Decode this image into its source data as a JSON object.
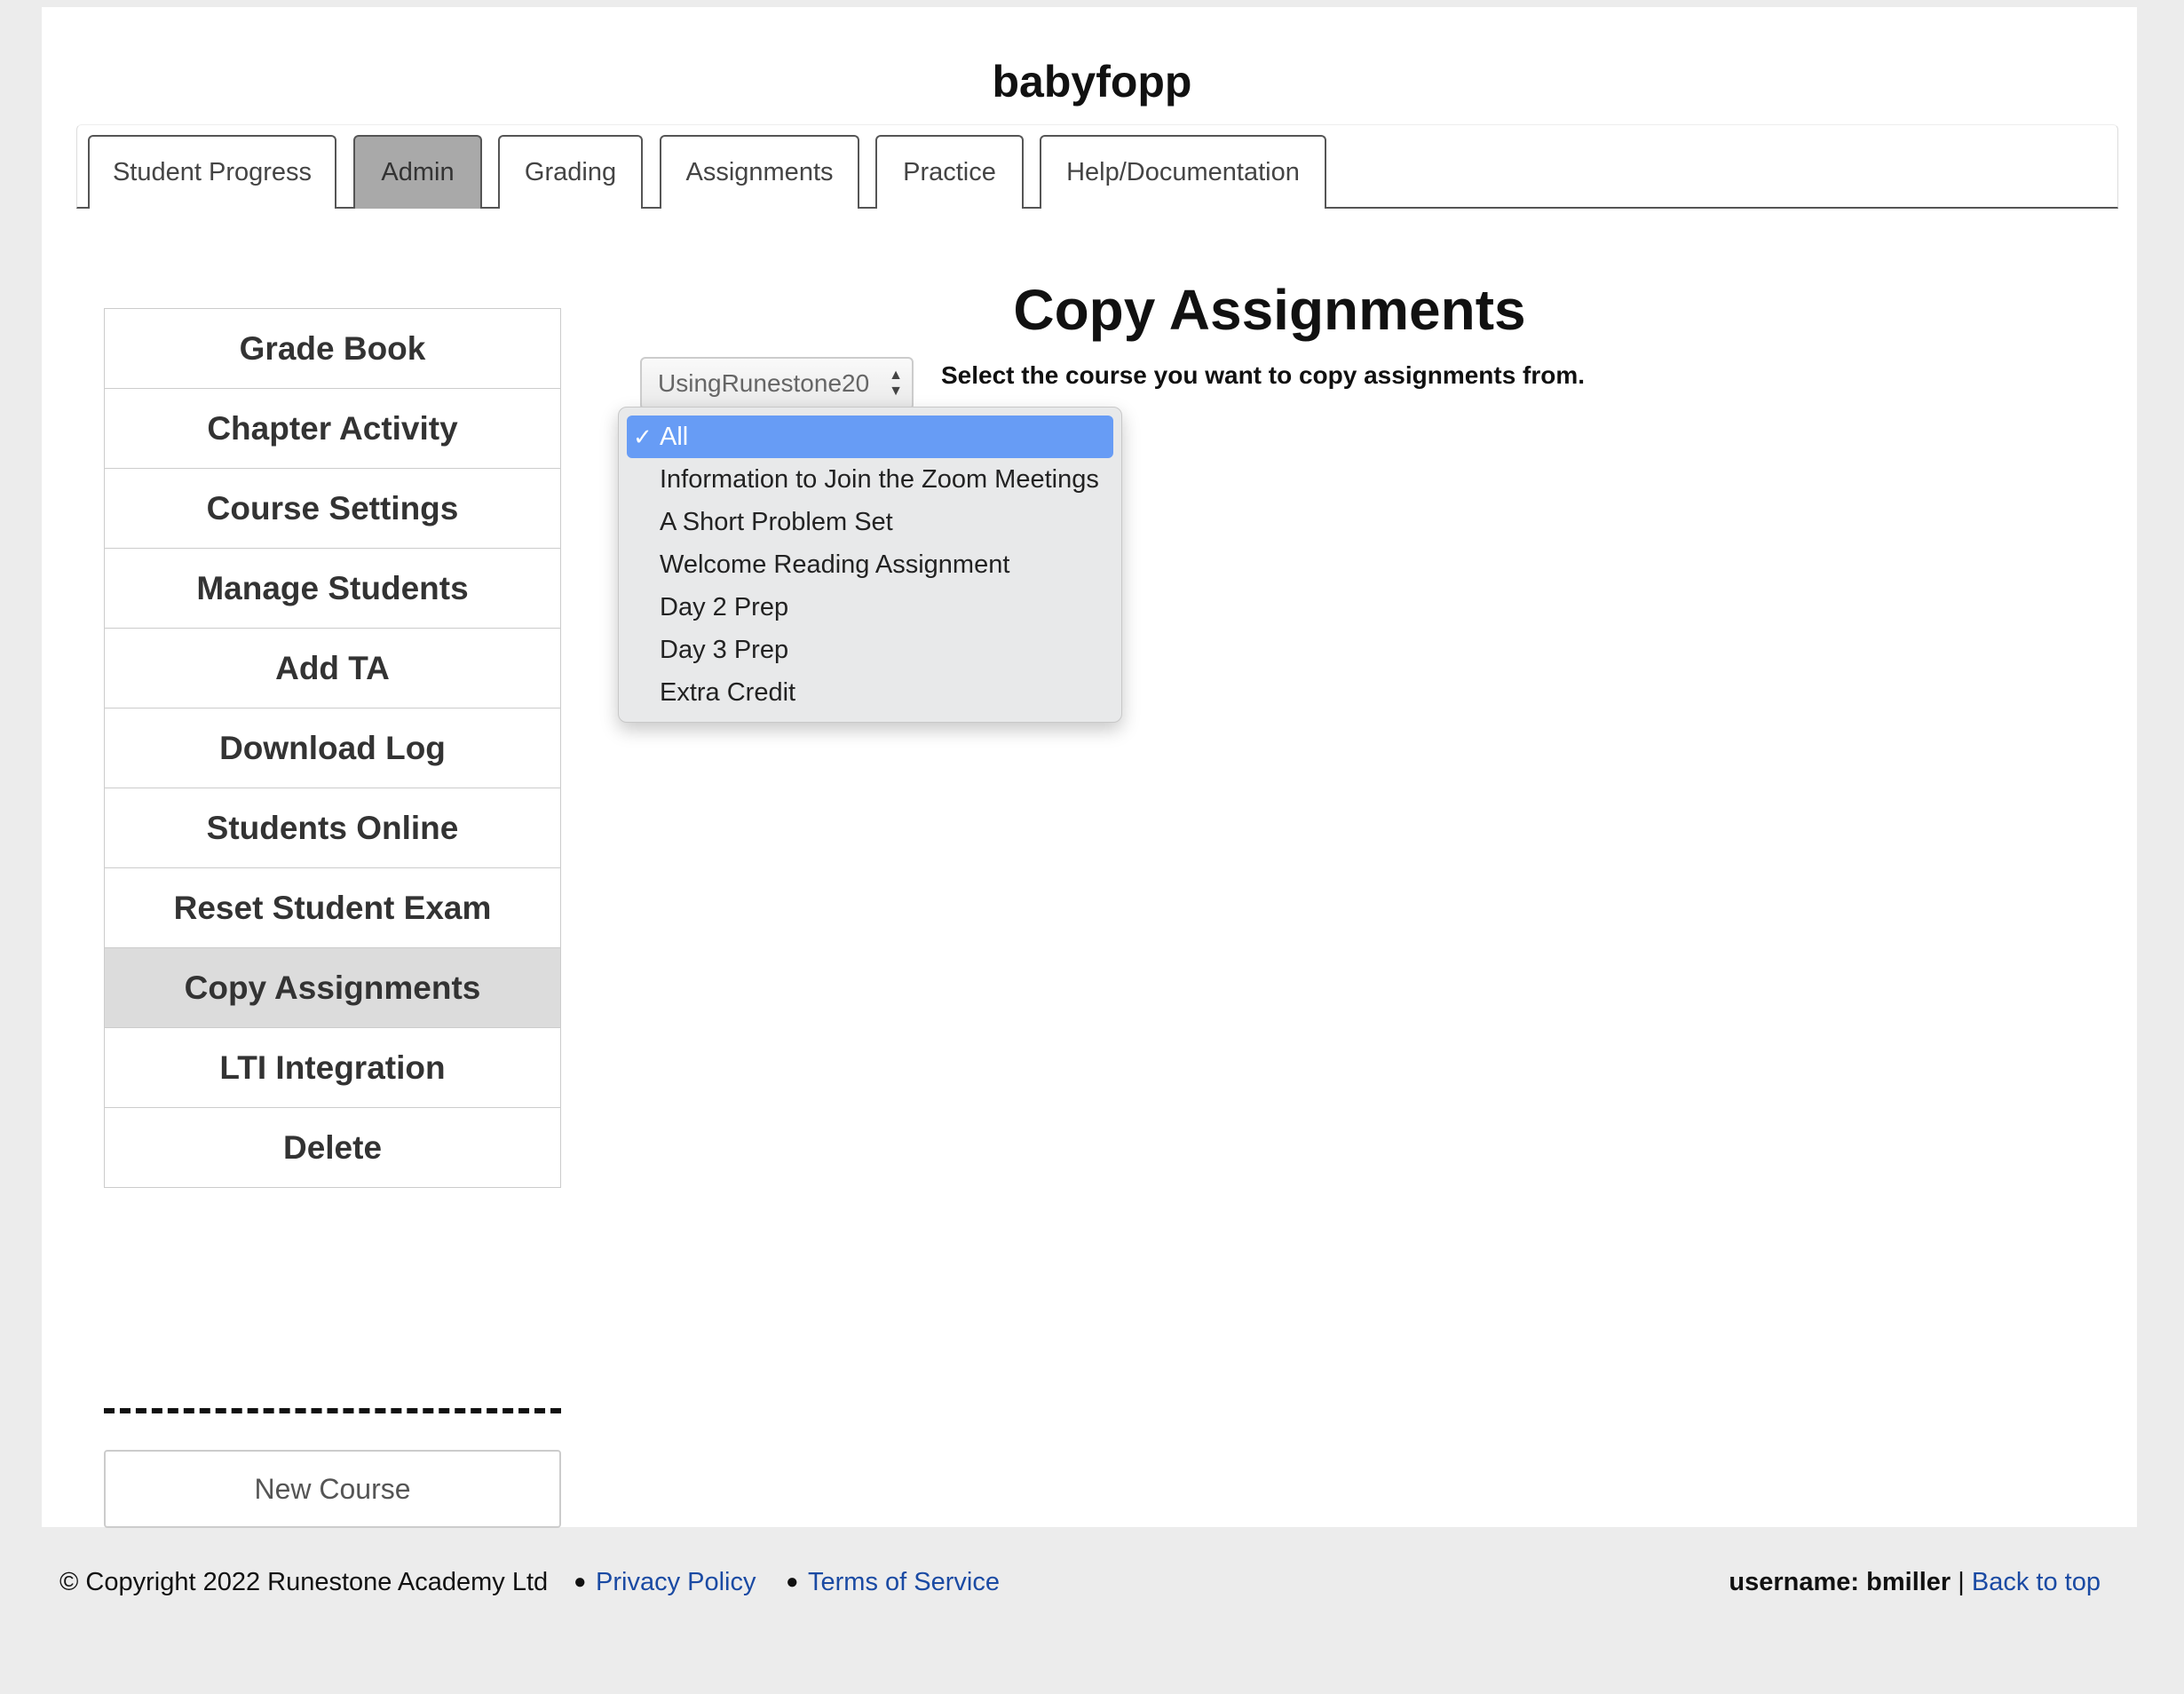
{
  "course": {
    "name": "babyfopp"
  },
  "tabs": [
    {
      "label": "Student Progress"
    },
    {
      "label": "Admin",
      "active": true
    },
    {
      "label": "Grading"
    },
    {
      "label": "Assignments"
    },
    {
      "label": "Practice"
    },
    {
      "label": "Help/Documentation"
    }
  ],
  "sidebar": {
    "items": [
      {
        "label": "Grade Book"
      },
      {
        "label": "Chapter Activity"
      },
      {
        "label": "Course Settings"
      },
      {
        "label": "Manage Students"
      },
      {
        "label": "Add TA"
      },
      {
        "label": "Download Log"
      },
      {
        "label": "Students Online"
      },
      {
        "label": "Reset Student Exam"
      },
      {
        "label": "Copy Assignments",
        "active": true
      },
      {
        "label": "LTI Integration"
      },
      {
        "label": "Delete"
      }
    ],
    "new_course_label": "New Course"
  },
  "main": {
    "heading": "Copy Assignments",
    "course_select": {
      "value": "UsingRunestone20"
    },
    "instructions": "Select the course you want to copy assignments from.",
    "dropdown": {
      "check_glyph": "✓",
      "options": [
        {
          "label": "All",
          "selected": true
        },
        {
          "label": "Information to Join the Zoom Meetings"
        },
        {
          "label": "A Short Problem Set"
        },
        {
          "label": "Welcome Reading Assignment"
        },
        {
          "label": "Day 2 Prep"
        },
        {
          "label": "Day 3 Prep"
        },
        {
          "label": "Extra Credit"
        }
      ]
    }
  },
  "footer": {
    "copyright": "© Copyright 2022 Runestone Academy Ltd",
    "bullet": "●",
    "privacy_label": "Privacy Policy",
    "terms_label": "Terms of Service",
    "username_label": "username: bmiller",
    "separator": "|",
    "back_to_top_label": "Back to top"
  },
  "colors": {
    "page_background": "#ececec",
    "active_tab": "#a9a9a9",
    "active_sidebar_item": "#dcdcdc",
    "dropdown_highlight": "#679cf5",
    "link": "#1a4aa3"
  }
}
